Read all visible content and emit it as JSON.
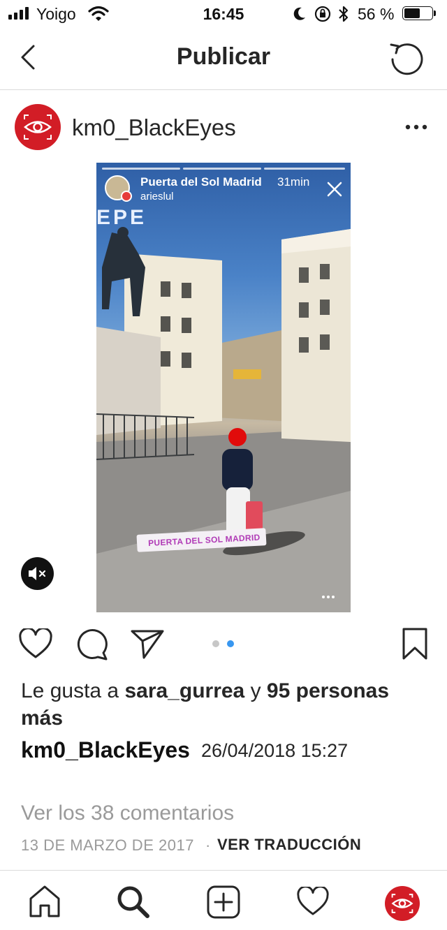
{
  "status_bar": {
    "carrier": "Yoigo",
    "time": "16:45",
    "battery_percent": "56 %"
  },
  "header": {
    "title": "Publicar",
    "back_icon": "chevron-left-icon",
    "refresh_icon": "rotate-ccw-icon"
  },
  "post": {
    "username": "km0_BlackEyes",
    "avatar_color": "#d21d26",
    "story": {
      "location": "Puerta del Sol Madrid",
      "age": "31min",
      "user": "arieslul",
      "sticker": "PUERTA DEL SOL MADRID",
      "sign_text": "EPE"
    },
    "carousel": {
      "total": 2,
      "active_index": 1,
      "active_color": "#3897f0"
    },
    "likes_prefix": "Le gusta a ",
    "likes_user": "sara_gurrea",
    "likes_middle": " y ",
    "likes_count_text": "95 personas más",
    "caption_user": "km0_BlackEyes",
    "caption_text": "26/04/2018 15:27",
    "comments_link": "Ver los 38 comentarios",
    "date": "13 DE MARZO DE 2017",
    "date_separator": "·",
    "translate_label": "VER TRADUCCIÓN"
  },
  "tab_bar": {
    "items": [
      "home-icon",
      "search-icon",
      "add-post-icon",
      "activity-heart-icon",
      "profile-avatar-icon"
    ]
  }
}
